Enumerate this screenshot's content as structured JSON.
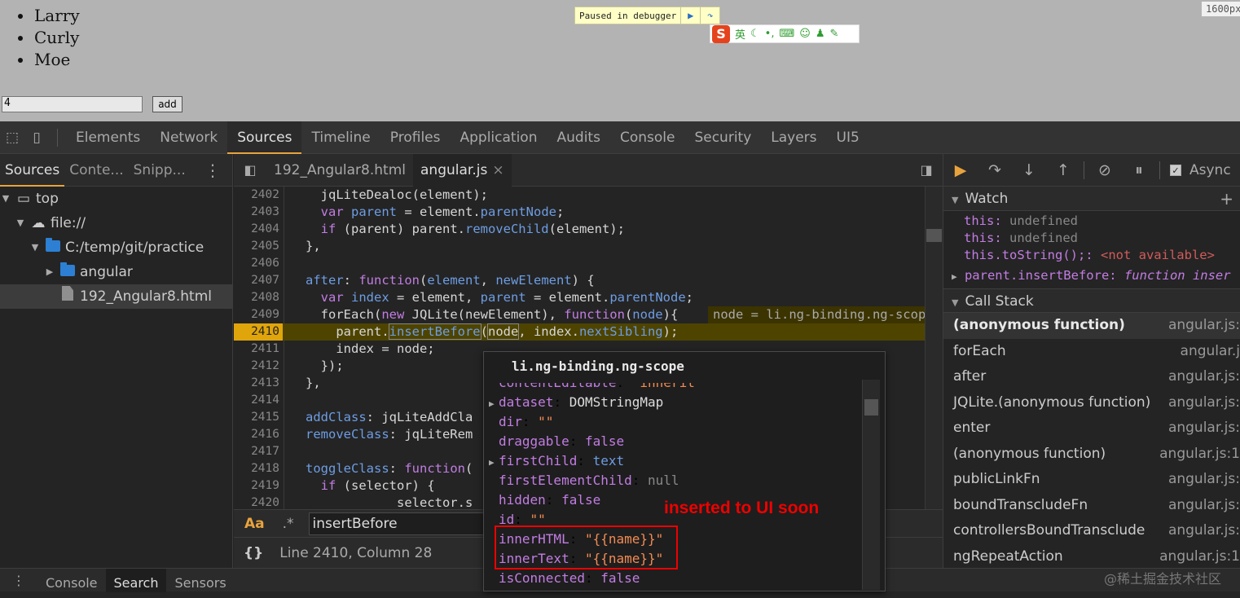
{
  "page": {
    "list_items": [
      "Larry",
      "Curly",
      "Moe"
    ],
    "input_value": "4",
    "add_button_label": "add",
    "paused_label": "Paused in debugger",
    "width_label": "1600px",
    "ime_char": "英"
  },
  "devtools": {
    "tabs": [
      "Elements",
      "Network",
      "Sources",
      "Timeline",
      "Profiles",
      "Application",
      "Audits",
      "Console",
      "Security",
      "Layers",
      "UI5"
    ],
    "active_tab": "Sources",
    "navigator": {
      "subtabs": [
        "Sources",
        "Conte...",
        "Snipp..."
      ],
      "tree": [
        {
          "label": "top",
          "depth": 0
        },
        {
          "label": "file://",
          "depth": 1
        },
        {
          "label": "C:/temp/git/practice",
          "depth": 2
        },
        {
          "label": "angular",
          "depth": 3
        },
        {
          "label": "192_Angular8.html",
          "depth": 3
        }
      ]
    },
    "editor": {
      "file_tabs": [
        "192_Angular8.html",
        "angular.js"
      ],
      "close_glyph": "×",
      "inline_value": "node = li.ng-binding.ng-scope",
      "line_numbers": [
        "2402",
        "2403",
        "2404",
        "2405",
        "2406",
        "2407",
        "2408",
        "2409",
        "2410",
        "2411",
        "2412",
        "2413",
        "2414",
        "2415",
        "2416",
        "2417",
        "2418",
        "2419",
        "2420"
      ],
      "lines": [
        "  jqLiteDealoc(element);",
        "  var parent = element.parentNode;",
        "  if (parent) parent.removeChild(element);",
        "},",
        "",
        "after: function(element, newElement) {",
        "  var index = element, parent = element.parentNode;",
        "  forEach(new JQLite(newElement), function(node){",
        "    parent.insertBefore(node, index.nextSibling);",
        "    index = node;",
        "  });",
        "},",
        "",
        "addClass: jqLiteAddCla",
        "removeClass: jqLiteRem",
        "",
        "toggleClass: function(",
        "  if (selector) {",
        "            selector.s"
      ],
      "search_query": "insertBefore",
      "search_aa": "Aa",
      "search_regex": ".*",
      "braces": "{}",
      "cursor_position": "Line 2410, Column 28"
    },
    "popover": {
      "title": "li.ng-binding.ng-scope",
      "props": [
        {
          "key": "contentEditable",
          "value": "\"inherit\"",
          "kind": "str",
          "expandable": false
        },
        {
          "key": "dataset",
          "value": "DOMStringMap",
          "kind": "obj",
          "expandable": true
        },
        {
          "key": "dir",
          "value": "\"\"",
          "kind": "str",
          "expandable": false
        },
        {
          "key": "draggable",
          "value": "false",
          "kind": "bool",
          "expandable": false
        },
        {
          "key": "firstChild",
          "value": "text",
          "kind": "txt",
          "expandable": true
        },
        {
          "key": "firstElementChild",
          "value": "null",
          "kind": "null",
          "expandable": false
        },
        {
          "key": "hidden",
          "value": "false",
          "kind": "bool",
          "expandable": false
        },
        {
          "key": "id",
          "value": "\"\"",
          "kind": "str",
          "expandable": false
        },
        {
          "key": "innerHTML",
          "value": "\"{{name}}\"",
          "kind": "str",
          "expandable": false
        },
        {
          "key": "innerText",
          "value": "\"{{name}}\"",
          "kind": "str",
          "expandable": false
        },
        {
          "key": "isConnected",
          "value": "false",
          "kind": "bool",
          "expandable": false
        }
      ]
    },
    "annotation": "inserted to UI soon",
    "right_panel": {
      "async_label": "Async",
      "watch_title": "Watch",
      "watch": [
        {
          "expr": "this:",
          "value": "undefined",
          "kind": "u"
        },
        {
          "expr": "this:",
          "value": "undefined",
          "kind": "u"
        },
        {
          "expr": "this.toString();:",
          "value": "<not available>",
          "kind": "na"
        }
      ],
      "watch_expanded": {
        "expr": "parent.insertBefore:",
        "value": "function inser"
      },
      "callstack_title": "Call Stack",
      "callstack": [
        {
          "fn": "(anonymous function)",
          "loc": "angular.js:"
        },
        {
          "fn": "forEach",
          "loc": "angular.j"
        },
        {
          "fn": "after",
          "loc": "angular.js:"
        },
        {
          "fn": "JQLite.(anonymous function)",
          "loc": "angular.js:"
        },
        {
          "fn": "enter",
          "loc": "angular.js:"
        },
        {
          "fn": "(anonymous function)",
          "loc": "angular.js:1"
        },
        {
          "fn": "publicLinkFn",
          "loc": "angular.js:"
        },
        {
          "fn": "boundTranscludeFn",
          "loc": "angular.js:"
        },
        {
          "fn": "controllersBoundTransclude",
          "loc": "angular.js:"
        },
        {
          "fn": "ngRepeatAction",
          "loc": "angular.js:1"
        }
      ]
    },
    "drawer_tabs": [
      "Console",
      "Search",
      "Sensors"
    ],
    "drawer_active": "Search"
  },
  "watermark": "@稀土掘金技术社区"
}
